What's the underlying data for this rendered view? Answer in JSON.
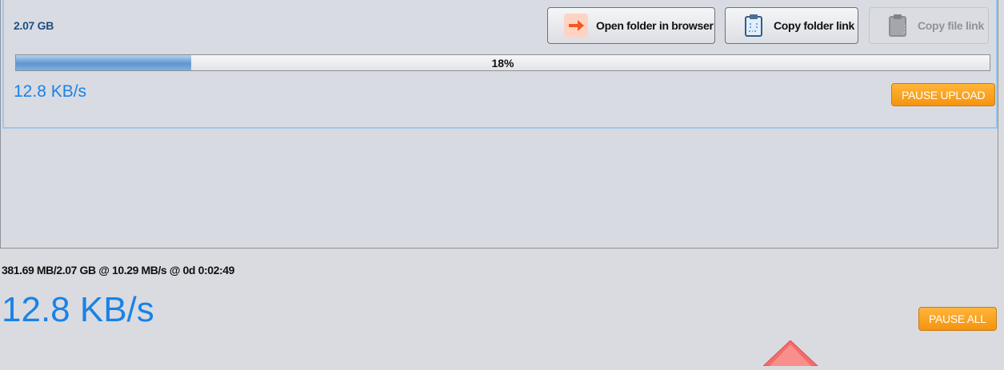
{
  "upload_item": {
    "size": "2.07 GB",
    "progress_percent": 18,
    "progress_text": "18%",
    "speed": "12.8 KB/s",
    "buttons": {
      "open_folder": "Open folder in browser",
      "copy_folder_link": "Copy folder link",
      "copy_file_link": "Copy file link"
    },
    "pause_upload": "PAUSE UPLOAD"
  },
  "footer": {
    "summary": "381.69 MB/2.07 GB @ 10.29 MB/s @ 0d 0:02:49",
    "speed": "12.8 KB/s",
    "pause_all": "PAUSE ALL"
  },
  "colors": {
    "accent_blue": "#1a82e6",
    "orange": "#f7a11f"
  },
  "icons": [
    "arrow-right-icon",
    "clipboard-icon",
    "clipboard-disabled-icon",
    "logo-icon"
  ]
}
